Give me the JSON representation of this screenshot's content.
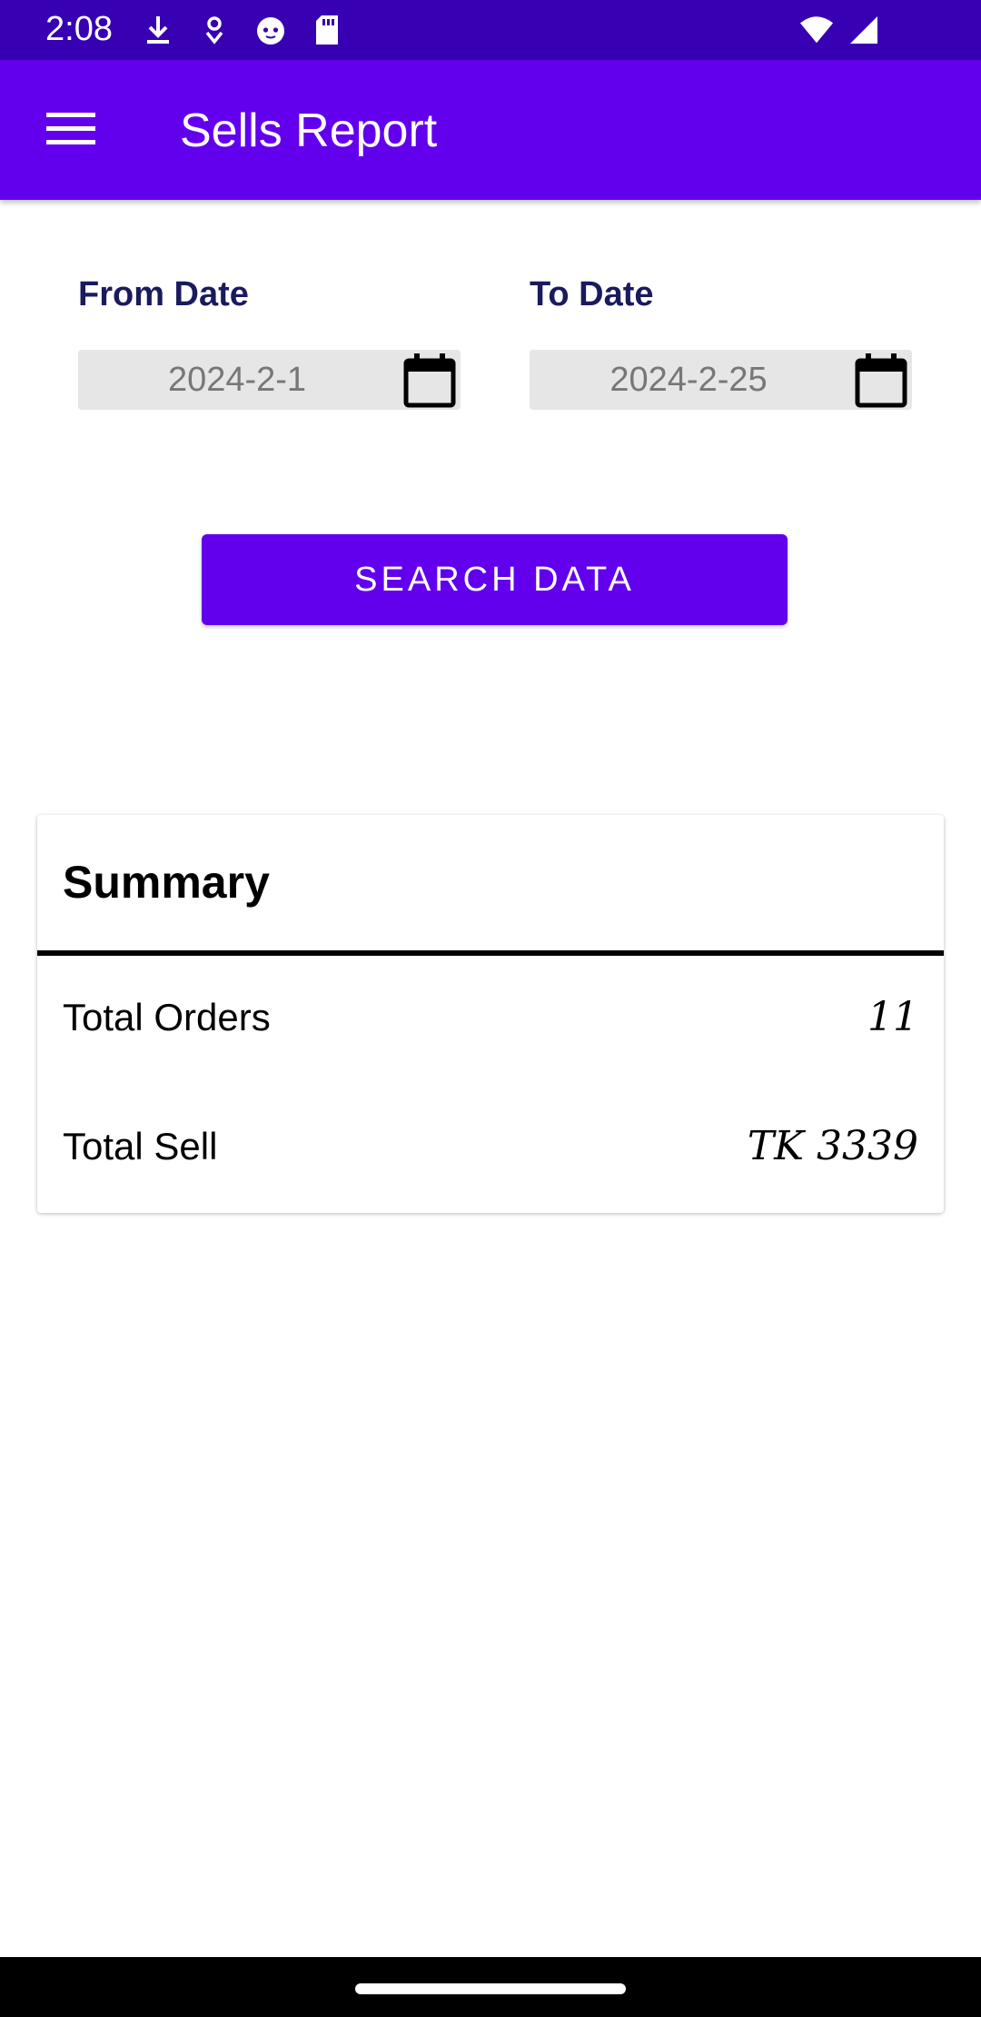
{
  "status_bar": {
    "time": "2:08",
    "icons": [
      "download-icon",
      "location-pin-icon",
      "cat-face-icon",
      "sd-card-icon",
      "wifi-icon",
      "signal-icon"
    ]
  },
  "app_bar": {
    "title": "Sells Report",
    "menu_icon": "hamburger-menu-icon"
  },
  "filters": {
    "from_label": "From Date",
    "from_value": "2024-2-1",
    "to_label": "To Date",
    "to_value": "2024-2-25",
    "calendar_icon": "calendar-icon"
  },
  "search_button_label": "SEARCH DATA",
  "summary": {
    "title": "Summary",
    "rows": [
      {
        "label": "Total Orders",
        "value": "11"
      },
      {
        "label": "Total Sell",
        "value": "TK 3339"
      }
    ]
  },
  "colors": {
    "status_bar": "#3700b3",
    "primary": "#6200ee",
    "label_navy": "#1a1a5e",
    "field_bg": "#e6e6e6"
  }
}
